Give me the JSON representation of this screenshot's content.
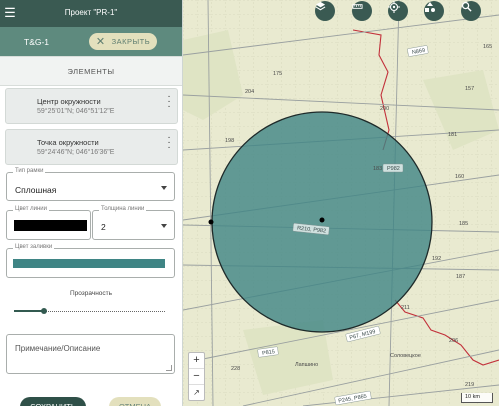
{
  "header": {
    "menu_icon": "hamburger-icon",
    "title": "Проект \"PR-1\""
  },
  "subheader": {
    "layer_name": "T&G-1",
    "close_label": "ЗАКРЫТЬ",
    "close_icon": "close-icon"
  },
  "section_title": "ЭЛЕМЕНТЫ",
  "elements": [
    {
      "name": "Центр окружности",
      "coords": "59°25'01\"N; 046°51'12\"E"
    },
    {
      "name": "Точка окружности",
      "coords": "59°24'46\"N; 046°16'36\"E"
    }
  ],
  "frame_type": {
    "label": "Тип рамки",
    "value": "Сплошная"
  },
  "line_color": {
    "label": "Цвет линии",
    "color": "#000000"
  },
  "line_width": {
    "label": "Толщина линии",
    "value": "2"
  },
  "fill_color": {
    "label": "Цвет заливки",
    "color": "#3f8585"
  },
  "transparency": {
    "label": "Прозрачность",
    "value": 0.2
  },
  "notes": {
    "placeholder": "Примечание/Описание"
  },
  "actions": {
    "save": "СОХРАНИТЬ",
    "cancel": "ОТМЕНА"
  },
  "map": {
    "toolbar": [
      "layers-icon",
      "ruler-icon",
      "locate-icon",
      "shapes-icon",
      "search-icon"
    ],
    "zoom_in": "+",
    "zoom_out": "−",
    "reset": "↗",
    "scale_label": "10 km",
    "labels": {
      "n869": "N869",
      "p982": "P982",
      "r210": "R210, P982",
      "p815": "P815",
      "m199": "P67, M199",
      "p865": "P245, P865",
      "lapshino": "Лапшино",
      "solovetskoe": "Соловецкое",
      "n219": "219",
      "n211": "211",
      "n206": "206",
      "n192": "192",
      "n185": "185",
      "n187": "187",
      "n181": "181",
      "n175": "175",
      "n200": "200",
      "n204": "204",
      "n198": "198",
      "n183": "183",
      "n160": "160",
      "n157": "157",
      "n165": "165",
      "n228": "228"
    },
    "colors": {
      "circle_fill": "#3f8585",
      "circle_stroke": "#1e2a2a",
      "background": "#e9ead0",
      "road": "#9aa0a0",
      "border": "#c2303a"
    }
  }
}
